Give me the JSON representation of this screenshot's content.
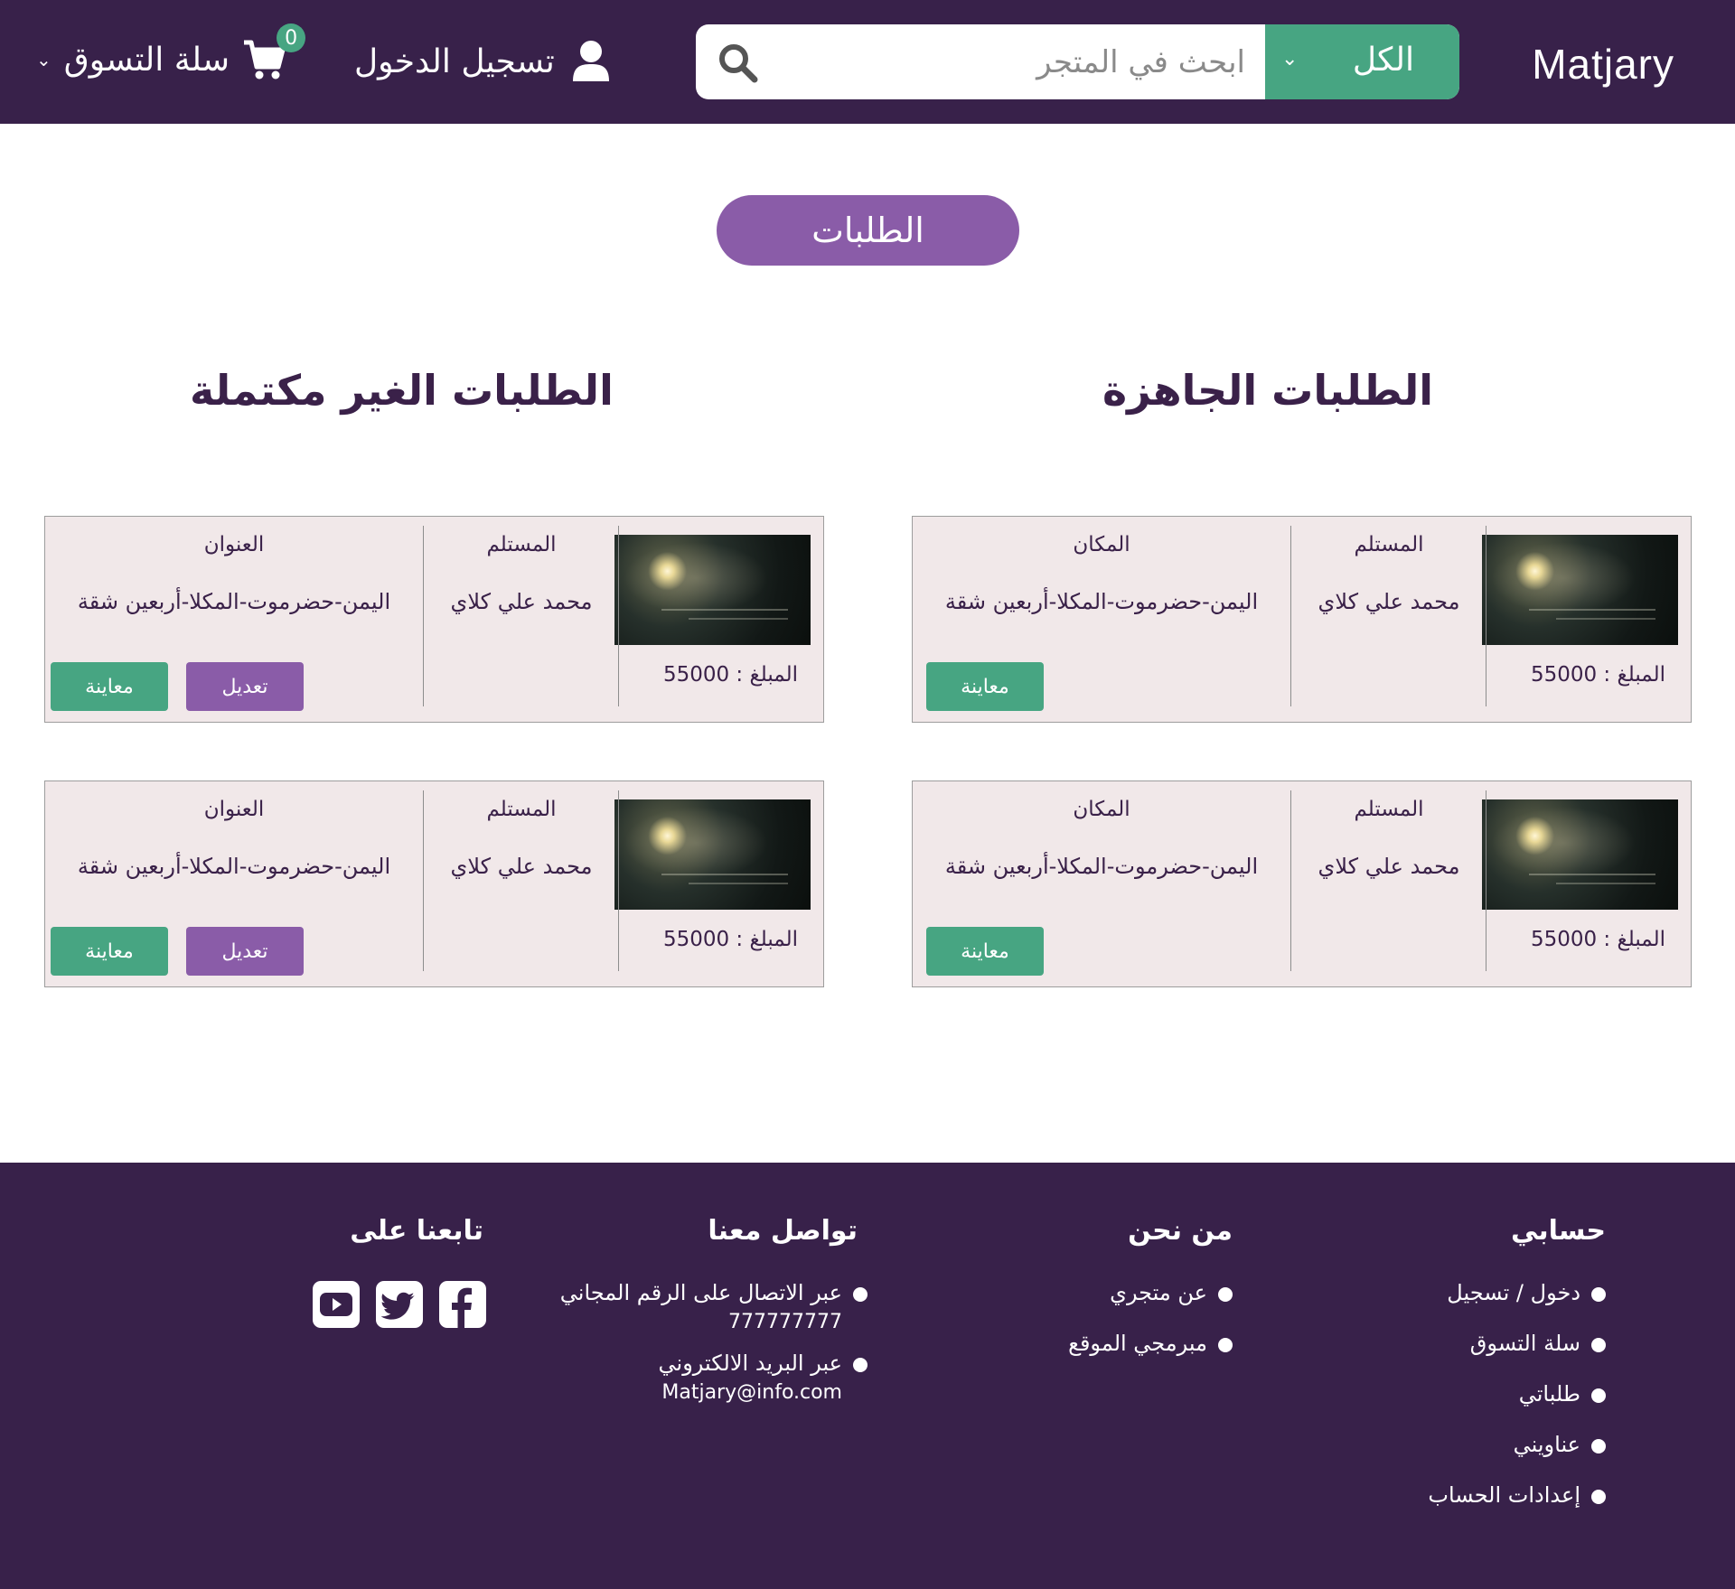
{
  "header": {
    "brand": "Matjary",
    "search": {
      "category": "الكل",
      "placeholder": "ابحث في المتجر"
    },
    "login_label": "تسجيل الدخول",
    "cart_label": "سلة التسوق",
    "cart_count": "0"
  },
  "page_title": "الطلبات",
  "sections": {
    "ready": {
      "title": "الطلبات الجاهزة",
      "orders": [
        {
          "amount": "المبلغ : 55000",
          "recipient_header": "المستلم",
          "recipient": "محمد علي كلاي",
          "location_header": "المكان",
          "location": "اليمن-حضرموت-المكلا-أربعين شقة",
          "view_label": "معاينة"
        },
        {
          "amount": "المبلغ : 55000",
          "recipient_header": "المستلم",
          "recipient": "محمد علي كلاي",
          "location_header": "المكان",
          "location": "اليمن-حضرموت-المكلا-أربعين شقة",
          "view_label": "معاينة"
        }
      ]
    },
    "incomplete": {
      "title": "الطلبات الغير مكتملة",
      "orders": [
        {
          "amount": "المبلغ : 55000",
          "recipient_header": "المستلم",
          "recipient": "محمد علي كلاي",
          "address_header": "العنوان",
          "address": "اليمن-حضرموت-المكلا-أربعين شقة",
          "edit_label": "تعديل",
          "view_label": "معاينة"
        },
        {
          "amount": "المبلغ : 55000",
          "recipient_header": "المستلم",
          "recipient": "محمد علي كلاي",
          "address_header": "العنوان",
          "address": "اليمن-حضرموت-المكلا-أربعين شقة",
          "edit_label": "تعديل",
          "view_label": "معاينة"
        }
      ]
    }
  },
  "footer": {
    "account": {
      "title": "حسابي",
      "items": [
        "دخول / تسجيل",
        "سلة التسوق",
        "طلباتي",
        "عناويني",
        "إعدادات الحساب"
      ]
    },
    "about": {
      "title": "من نحن",
      "items": [
        "عن متجري",
        "مبرمجي الموقع"
      ]
    },
    "contact": {
      "title": "تواصل معنا",
      "items": [
        {
          "label": "عبر الاتصال على الرقم المجاني",
          "value": "777777777"
        },
        {
          "label": "عبر البريد الالكتروني",
          "value": "Matjary@info.com"
        }
      ]
    },
    "follow": {
      "title": "تابعنا على",
      "icons": [
        "facebook-icon",
        "twitter-icon",
        "youtube-icon"
      ]
    }
  },
  "colors": {
    "header_bg": "#38214a",
    "accent_green": "#47a582",
    "accent_purple": "#8a5ca8",
    "card_bg": "#f1e8e9"
  }
}
